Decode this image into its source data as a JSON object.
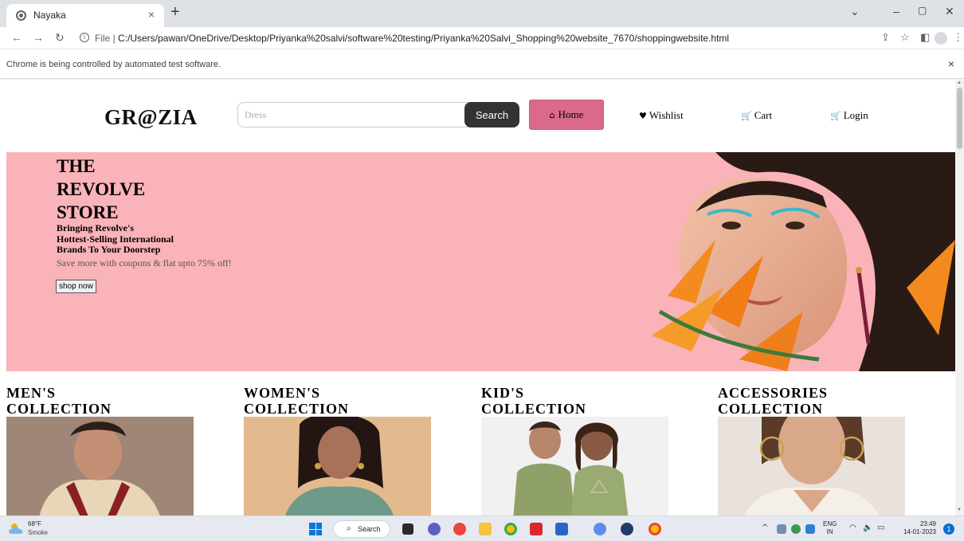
{
  "browser": {
    "tab_title": "Nayaka",
    "tab_close": "×",
    "new_tab": "+",
    "file_label": "File |",
    "url": "C:/Users/pawan/OneDrive/Desktop/Priyanka%20salvi/software%20testing/Priyanka%20Salvi_Shopping%20website_7670/shoppingwebsite.html",
    "infobar_text": "Chrome is being controlled by automated test software.",
    "infobar_close": "×",
    "icons": [
      "back-arrow",
      "forward-arrow",
      "reload",
      "info",
      "share",
      "star-bookmark",
      "side-panel",
      "profile",
      "kebab-menu",
      "minimize",
      "restore",
      "close"
    ]
  },
  "site": {
    "logo": "GR@ZIA",
    "search": {
      "placeholder": "Dress",
      "button": "Search"
    },
    "nav": [
      {
        "icon": "home-icon",
        "glyph": "🏠",
        "label": "Home",
        "active": true
      },
      {
        "icon": "heart-icon",
        "glyph": "♥",
        "label": "Wishlist"
      },
      {
        "icon": "cart-icon",
        "glyph": "🛒",
        "label": "Cart"
      },
      {
        "icon": "cart-icon",
        "glyph": "🛒",
        "label": "Login"
      }
    ],
    "hero": {
      "title_lines": [
        "THE",
        "REVOLVE",
        "STORE"
      ],
      "subtitle_lines": [
        "Bringing Revolve's",
        "Hottest-Selling International",
        "Brands To Your Doorstep"
      ],
      "save_text": "Save more with coupons & flat upto 75% off!",
      "cta": "shop now",
      "background": "#fab3b8"
    },
    "collections": [
      {
        "line1": "MEN'S",
        "line2": "COLLECTION"
      },
      {
        "line1": "WOMEN'S",
        "line2": "COLLECTION"
      },
      {
        "line1": "KID'S",
        "line2": "COLLECTION"
      },
      {
        "line1": "ACCESSORIES",
        "line2": "COLLECTION"
      }
    ],
    "colors": {
      "home_button": "#d96a8a",
      "search_button": "#333333"
    }
  },
  "taskbar": {
    "weather_temp": "68°F",
    "weather_desc": "Smoke",
    "search_label": "Search",
    "lang_top": "ENG",
    "lang_bottom": "IN",
    "time": "23:49",
    "date": "14-01-2023",
    "notification_count": "1"
  }
}
